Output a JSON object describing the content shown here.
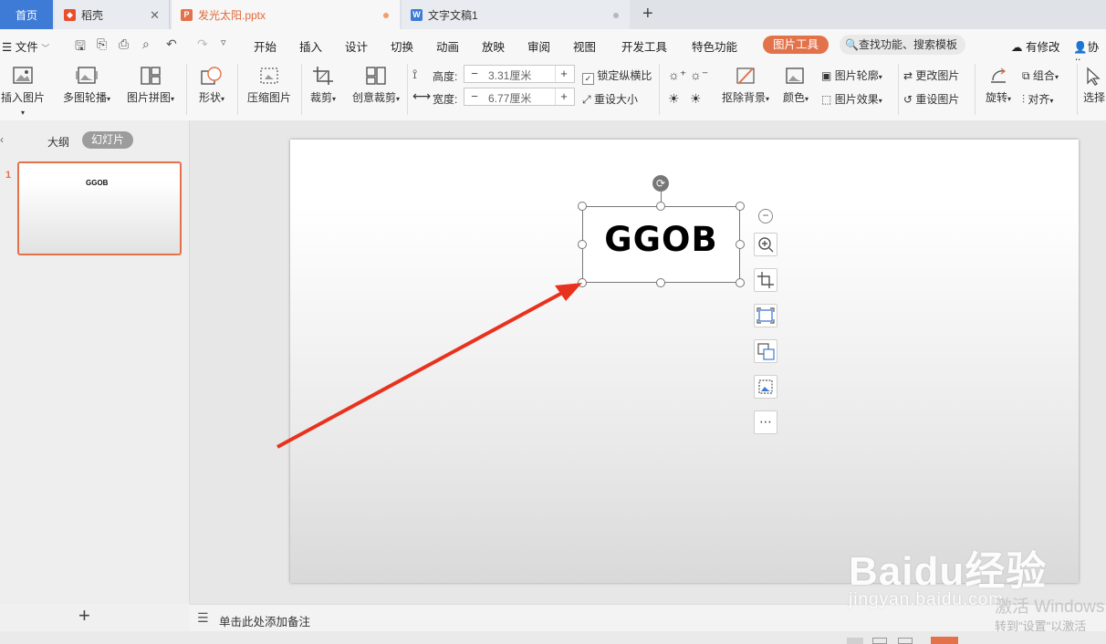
{
  "tabs": {
    "home": "首页",
    "daoke": "稻壳",
    "ppt": "发光太阳.pptx",
    "doc": "文字文稿1"
  },
  "menu": {
    "file": "文件",
    "items": [
      "开始",
      "插入",
      "设计",
      "切换",
      "动画",
      "放映",
      "审阅",
      "视图",
      "开发工具",
      "特色功能"
    ],
    "picture_tools": "图片工具",
    "search": "查找功能、搜索模板",
    "has_changes": "有修改",
    "collab": "协作"
  },
  "ribbon": {
    "insert_picture": "插入图片",
    "multi_carousel": "多图轮播",
    "picture_collage": "图片拼图",
    "shape": "形状",
    "compress": "压缩图片",
    "crop": "裁剪",
    "creative_crop": "创意裁剪",
    "height_label": "高度:",
    "height_value": "3.31厘米",
    "width_label": "宽度:",
    "width_value": "6.77厘米",
    "lock_ratio": "锁定纵横比",
    "reset_size": "重设大小",
    "remove_bg": "抠除背景",
    "color": "颜色",
    "outline": "图片轮廓",
    "effect": "图片效果",
    "change_picture": "更改图片",
    "reset_picture": "重设图片",
    "rotate": "旋转",
    "group": "组合",
    "align": "对齐",
    "select": "选择"
  },
  "left_panel": {
    "outline_tab": "大纲",
    "slides_tab": "幻灯片",
    "slide_number": "1",
    "thumb_text": "GGOB"
  },
  "slide": {
    "picture_text": "GGOB"
  },
  "notes": {
    "placeholder": "单击此处添加备注"
  },
  "watermark": {
    "brand": "Baidu经验",
    "url": "jingyan.baidu.com",
    "activate_title": "激活 Windows",
    "activate_sub": "转到\"设置\"以激活"
  },
  "colors": {
    "accent": "#e3724a",
    "home_tab": "#3e7bd6",
    "arrow": "#e8321e"
  }
}
